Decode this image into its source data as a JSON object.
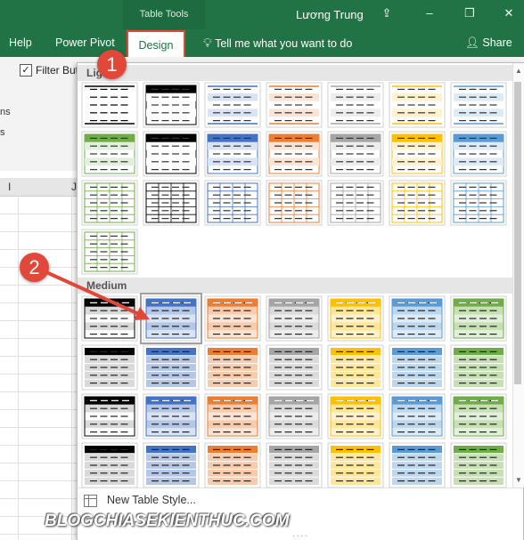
{
  "titlebar": {
    "tools_label": "Table Tools",
    "user": "Lương Trung",
    "colors": {
      "bar": "#217346"
    }
  },
  "tabs": {
    "help": "Help",
    "power_pivot": "Power Pivot",
    "design": "Design",
    "tell_me": "Tell me what you want to do",
    "share": "Share"
  },
  "ribbon": {
    "filter_label": "Filter Butt",
    "left_frag_1": "ns",
    "left_frag_2": "s"
  },
  "sheet": {
    "col_i": "I",
    "col_j": "J"
  },
  "gallery": {
    "light_label": "Light",
    "medium_label": "Medium",
    "new_style": "New Table Style...",
    "grip": "....",
    "palette": [
      "#000000",
      "#4472c4",
      "#ed7d31",
      "#a5a5a5",
      "#ffc000",
      "#5b9bd5",
      "#70ad47"
    ],
    "selected_style": "Medium 2"
  },
  "annotations": {
    "badge1": "1",
    "badge2": "2",
    "accent": "#e2483a"
  },
  "watermark": "BLOGCHIASEKIENTHUC.COM"
}
